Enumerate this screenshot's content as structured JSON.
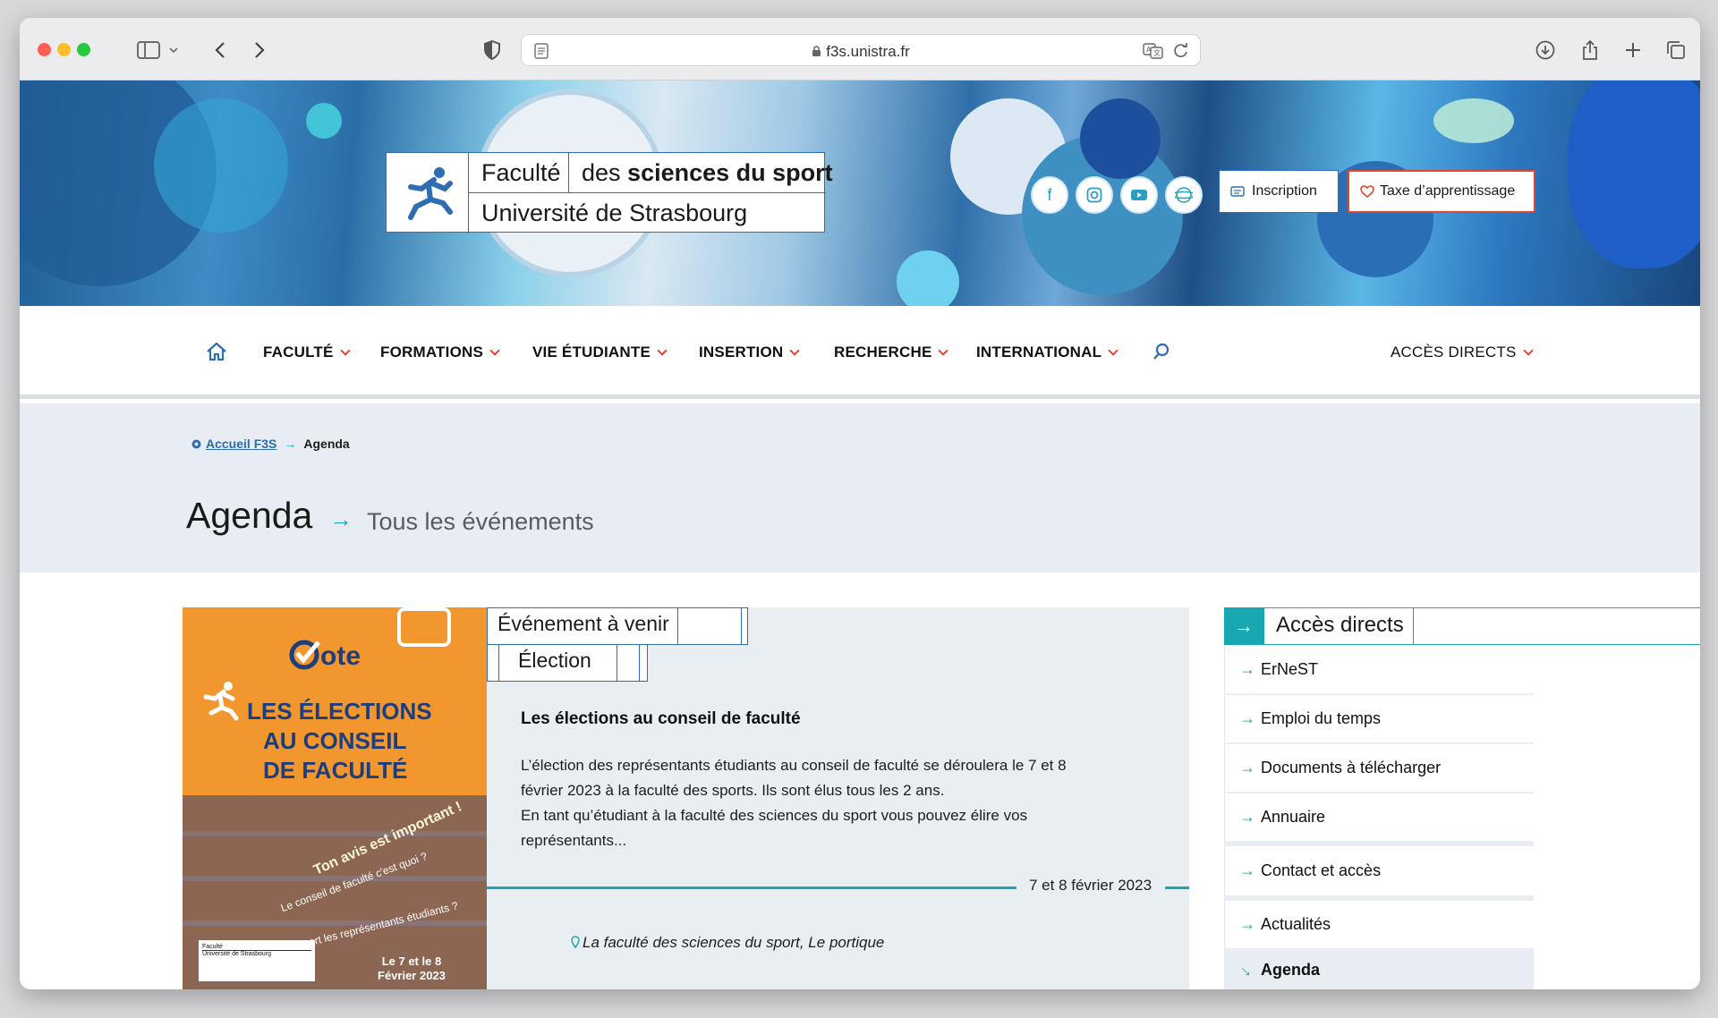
{
  "browser": {
    "url": "f3s.unistra.fr"
  },
  "header": {
    "logo_faculte": "Faculté",
    "logo_des": "des ",
    "logo_sciences": "sciences du sport",
    "logo_universite": "Université de Strasbourg",
    "inscription_label": "Inscription",
    "taxe_label": "Taxe d’apprentissage",
    "socials": [
      "facebook-icon",
      "instagram-icon",
      "youtube-icon",
      "globe-icon"
    ]
  },
  "nav": {
    "items": [
      "FACULTÉ",
      "FORMATIONS",
      "VIE ÉTUDIANTE",
      "INSERTION",
      "RECHERCHE",
      "INTERNATIONAL"
    ],
    "direct": "ACCÈS DIRECTS"
  },
  "breadcrumb": {
    "home": "Accueil F3S",
    "current": "Agenda"
  },
  "page": {
    "title": "Agenda",
    "subtitle": "Tous les événements"
  },
  "event": {
    "tag_status": "Événement à venir",
    "tag_category": "Élection",
    "title": "Les élections au conseil de faculté",
    "description_1": "L’élection des représentants étudiants au conseil de faculté se déroulera le 7 et 8",
    "description_2": "février 2023 à la faculté des sports. Ils sont élus tous les 2 ans.",
    "description_3": "En tant qu’étudiant à la faculté des sciences du sport vous pouvez élire vos",
    "description_4": "représentants...",
    "date": "7 et 8 février 2023",
    "location": "La faculté des sciences du sport, Le portique",
    "poster": {
      "vote": "ote",
      "line1": "LES ÉLECTIONS",
      "line2": "AU CONSEIL",
      "line3": "DE FACULTÉ",
      "slogan": "Ton avis est important !",
      "q1": "Le conseil de faculté c'est quoi ?",
      "q2": "À quoi sert les représentants étudiants ?",
      "date1": "Le 7 et le 8",
      "date2": "Février 2023"
    }
  },
  "sidebar": {
    "title": "Accès directs",
    "items": [
      "ErNeST",
      "Emploi du temps",
      "Documents à télécharger",
      "Annuaire",
      "Contact et accès",
      "Actualités",
      "Agenda"
    ]
  },
  "colors": {
    "accent_teal": "#17a8b4",
    "accent_red": "#e2462e",
    "brand_blue": "#2d6db3",
    "band_bg": "#e7edf2"
  }
}
